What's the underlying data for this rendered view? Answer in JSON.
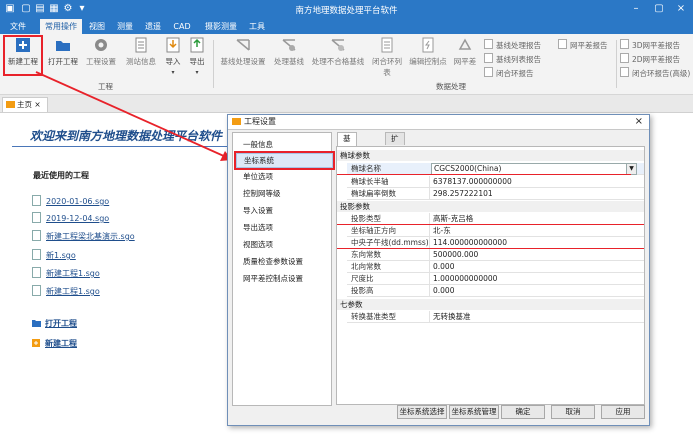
{
  "app": {
    "title": "南方地理数据处理平台软件"
  },
  "menu": {
    "items": [
      "文件",
      "常用操作",
      "视图",
      "测量",
      "遗遥",
      "CAD",
      "摄影测量",
      "工具"
    ]
  },
  "ribbon": {
    "file_buttons": [
      "新建工程",
      "打开工程",
      "工程设置",
      "测站信息",
      "导入",
      "导出"
    ],
    "file_group_label": "工程",
    "process_buttons": [
      "基线处理设置",
      "处理基线",
      "处理不合格基线",
      "闭合环列表",
      "编辑控制点",
      "网平差"
    ],
    "report_buttons": [
      "基线处理报告",
      "网平差报告",
      "基线列表报告",
      "闭合环报告"
    ],
    "extra_reports": [
      "3D网平差报告",
      "2D网平差报告",
      "闭合环报告(高级)"
    ],
    "process_group_label": "数据处理"
  },
  "doc_tab": {
    "label": "主页",
    "close": "×"
  },
  "home": {
    "welcome": "欢迎来到南方地理数据处理平台软件",
    "recent_title": "最近使用的工程",
    "recent": [
      "2020-01-06.sgo",
      "2019-12-04.sgo",
      "新建工程梁北基演示.sgo",
      "新1.sgo",
      "新建工程1.sgo",
      "新建工程1.sgo"
    ],
    "open_project": "打开工程",
    "new_project": "新建工程"
  },
  "dialog": {
    "title": "工程设置",
    "close": "×",
    "nav": [
      "一般信息",
      "坐标系统",
      "单位选项",
      "控制网等级",
      "导入设置",
      "导出选项",
      "视图选项",
      "质量检查参数设置",
      "网平差控制点设置"
    ],
    "tabs": [
      "基本参数",
      "扩展参数"
    ],
    "section_ellipsoid": "椭球参数",
    "ellipsoid_name_key": "椭球名称",
    "ellipsoid_name_value": "CGCS2000(China)",
    "semi_major_key": "椭球长半轴",
    "semi_major_value": "6378137.000000000",
    "inv_flat_key": "椭球扁率倒数",
    "inv_flat_value": "298.257222101",
    "section_projection": "投影参数",
    "proj_type_key": "投影类型",
    "proj_type_value": "高斯-克吕格",
    "axis_dir_key": "坐标轴正方向",
    "axis_dir_value": "北-东",
    "central_meridian_key": "中央子午线(dd.mmss)",
    "central_meridian_value": "114.000000000000",
    "false_east_key": "东向常数",
    "false_east_value": "500000.000",
    "false_north_key": "北向常数",
    "false_north_value": "0.000",
    "scale_key": "尺度比",
    "scale_value": "1.000000000000",
    "proj_height_key": "投影高",
    "proj_height_value": "0.000",
    "section_seven": "七参数",
    "transform_key": "转换基准类型",
    "transform_value": "无转换基准",
    "buttons": [
      "坐标系统选择",
      "坐标系统管理",
      "确定",
      "取消",
      "应用"
    ]
  },
  "colors": {
    "accent": "#2b78c6",
    "highlight": "#e8222a",
    "link": "#1f4e8c"
  }
}
